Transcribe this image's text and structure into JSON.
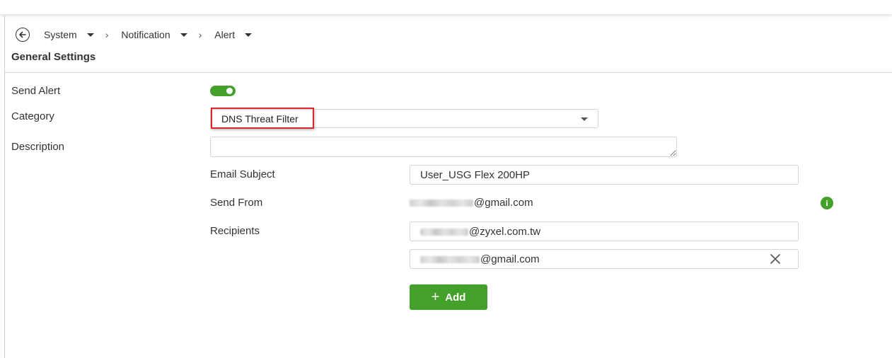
{
  "breadcrumb": {
    "items": [
      "System",
      "Notification",
      "Alert"
    ]
  },
  "section_title": "General Settings",
  "form": {
    "send_alert": {
      "label": "Send Alert",
      "enabled": true
    },
    "category": {
      "label": "Category",
      "value": "DNS Threat Filter"
    },
    "description": {
      "label": "Description",
      "value": ""
    },
    "email_subject": {
      "label": "Email Subject",
      "value": "User_USG Flex 200HP"
    },
    "send_from": {
      "label": "Send From",
      "value_suffix": "@gmail.com"
    },
    "recipients": {
      "label": "Recipients",
      "items": [
        {
          "value_suffix": "@zyxel.com.tw"
        },
        {
          "value_suffix": "@gmail.com"
        }
      ]
    },
    "add_button": {
      "label": "Add"
    }
  },
  "colors": {
    "accent": "#43a02b",
    "highlight": "#e0242b"
  },
  "icons": {
    "back": "arrow-left-circle-icon",
    "info": "info-icon",
    "remove": "close-icon",
    "add": "plus-icon"
  }
}
